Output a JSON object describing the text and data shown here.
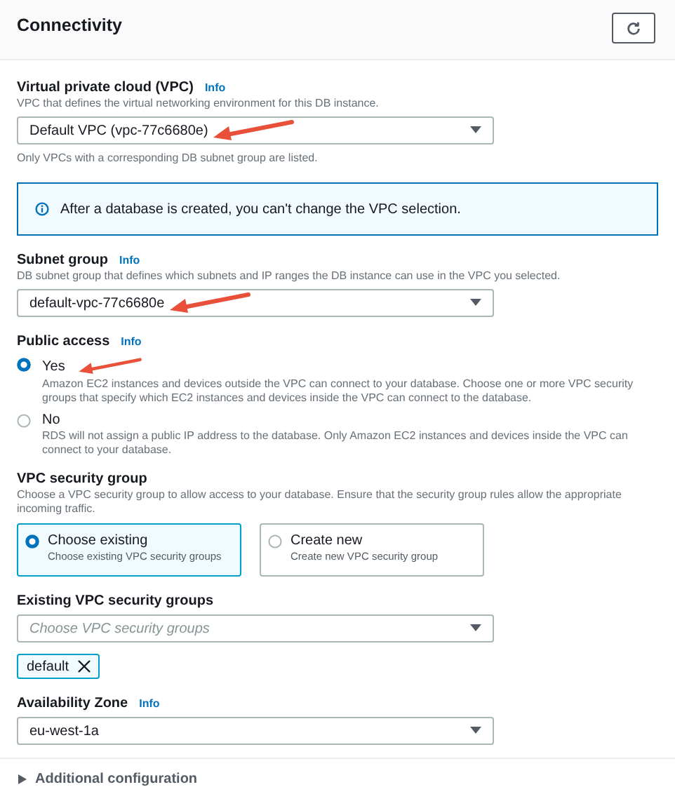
{
  "header": {
    "title": "Connectivity"
  },
  "sections": [
    {
      "kind": "select",
      "label": "Virtual private cloud (VPC)",
      "info": "Info",
      "description": "VPC that defines the virtual networking environment for this DB instance.",
      "value": "Default VPC (vpc-77c6680e)",
      "note": "Only VPCs with a corresponding DB subnet group are listed.",
      "annotated": true
    },
    {
      "kind": "alert",
      "text": "After a database is created, you can't change the VPC selection."
    },
    {
      "kind": "select",
      "label": "Subnet group",
      "info": "Info",
      "description": "DB subnet group that defines which subnets and IP ranges the DB instance can use in the VPC you selected.",
      "value": "default-vpc-77c6680e",
      "annotated": true
    },
    {
      "kind": "radio",
      "label": "Public access",
      "info": "Info",
      "options": [
        {
          "label": "Yes",
          "description": "Amazon EC2 instances and devices outside the VPC can connect to your database. Choose one or more VPC security groups that specify which EC2 instances and devices inside the VPC can connect to the database.",
          "selected": true,
          "annotated": true
        },
        {
          "label": "No",
          "description": "RDS will not assign a public IP address to the database. Only Amazon EC2 instances and devices inside the VPC can connect to your database.",
          "selected": false,
          "annotated": false
        }
      ]
    },
    {
      "kind": "tiles",
      "label": "VPC security group",
      "description": "Choose a VPC security group to allow access to your database. Ensure that the security group rules allow the appropriate incoming traffic.",
      "tiles": [
        {
          "title": "Choose existing",
          "description": "Choose existing VPC security groups",
          "selected": true
        },
        {
          "title": "Create new",
          "description": "Create new VPC security group",
          "selected": false
        }
      ]
    },
    {
      "kind": "multiselect",
      "label": "Existing VPC security groups",
      "placeholder": "Choose VPC security groups",
      "tokens": [
        "default"
      ]
    },
    {
      "kind": "select",
      "label": "Availability Zone",
      "info": "Info",
      "value": "eu-west-1a",
      "annotated": false
    }
  ],
  "footer": {
    "label": "Additional configuration",
    "expanded": false
  }
}
